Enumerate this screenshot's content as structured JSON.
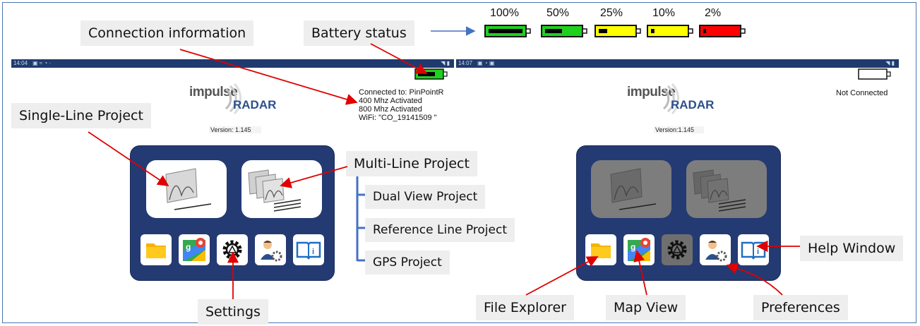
{
  "callouts": {
    "connection": "Connection information",
    "battery": "Battery status",
    "single_line": "Single-Line Project",
    "multi_line": "Multi-Line Project",
    "dual_view": "Dual View Project",
    "reference_line": "Reference Line Project",
    "gps": "GPS Project",
    "settings": "Settings",
    "help": "Help Window",
    "file_explorer": "File Explorer",
    "map_view": "Map View",
    "preferences": "Preferences"
  },
  "battery_legend": [
    {
      "label": "100%",
      "level": 1.0,
      "color": "#1fd11f"
    },
    {
      "label": "50%",
      "level": 0.5,
      "color": "#1fd11f"
    },
    {
      "label": "25%",
      "level": 0.25,
      "color": "#ffff00"
    },
    {
      "label": "10%",
      "level": 0.1,
      "color": "#ffff00"
    },
    {
      "label": "2%",
      "level": 0.02,
      "color": "#ff0000"
    }
  ],
  "left_screen": {
    "status_time": "14:04",
    "brand_impulse": "impulse",
    "brand_radar": "RADAR",
    "version": "Version: 1.145",
    "connection_lines": [
      "Connected to: PinPointR",
      "400 Mhz Activated",
      "800 Mhz Activated",
      "WiFi: \"CO_19141509 \""
    ],
    "battery_level": 0.75
  },
  "right_screen": {
    "status_time": "14:07",
    "brand_impulse": "impulse",
    "brand_radar": "RADAR",
    "version": "Version:1.145",
    "connection_status": "Not Connected",
    "battery_level": 0
  },
  "icons": [
    "folder-icon",
    "map-icon",
    "settings-gear-icon",
    "preferences-user-icon",
    "help-book-icon"
  ],
  "colors": {
    "panel": "#243a73",
    "status_bar": "#1f3a6e",
    "arrow": "#e00000",
    "bracket": "#4472c4"
  }
}
